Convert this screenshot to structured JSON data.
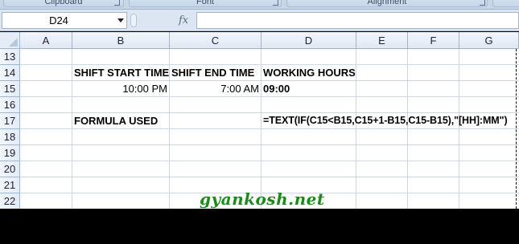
{
  "ribbon": {
    "groups": [
      "Clipboard",
      "Font",
      "Alignment"
    ]
  },
  "formula_bar": {
    "name_box": "D24",
    "fx_label": "fx",
    "formula": ""
  },
  "columns": [
    "A",
    "B",
    "C",
    "D",
    "E",
    "F",
    "G"
  ],
  "rows": [
    "13",
    "14",
    "15",
    "16",
    "17",
    "18",
    "19",
    "20",
    "21",
    "22"
  ],
  "cells": {
    "B14": "SHIFT START TIME",
    "C14": "SHIFT END TIME",
    "D14": "WORKING HOURS",
    "B15": "10:00 PM",
    "C15": "7:00 AM",
    "D15": "09:00",
    "B17": "FORMULA USED",
    "D17": "=TEXT(IF(C15<B15,C15+1-B15,C15-B15),\"[HH]:MM\")"
  },
  "watermark": "gyankosh.net"
}
